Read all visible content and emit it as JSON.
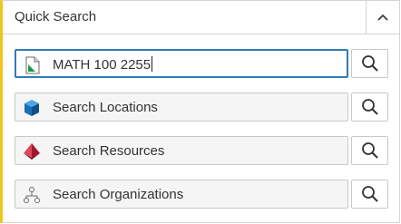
{
  "panel": {
    "title": "Quick Search",
    "collapse_icon": "chevron-up-icon"
  },
  "rows": [
    {
      "icon": "course-section-icon",
      "value": "MATH 100 2255",
      "placeholder": "",
      "search_icon": "magnifier-icon"
    },
    {
      "icon": "location-cube-icon",
      "value": "",
      "placeholder": "Search Locations",
      "search_icon": "magnifier-icon"
    },
    {
      "icon": "resource-pyramid-icon",
      "value": "",
      "placeholder": "Search Resources",
      "search_icon": "magnifier-icon"
    },
    {
      "icon": "organization-tree-icon",
      "value": "",
      "placeholder": "Search Organizations",
      "search_icon": "magnifier-icon"
    }
  ],
  "colors": {
    "accent_left_border": "#f3c317",
    "active_border": "#2f7db5",
    "course_icon_green": "#1a9a4a",
    "location_cube_blue": "#1b6fb0",
    "resource_red": "#c0223a"
  }
}
